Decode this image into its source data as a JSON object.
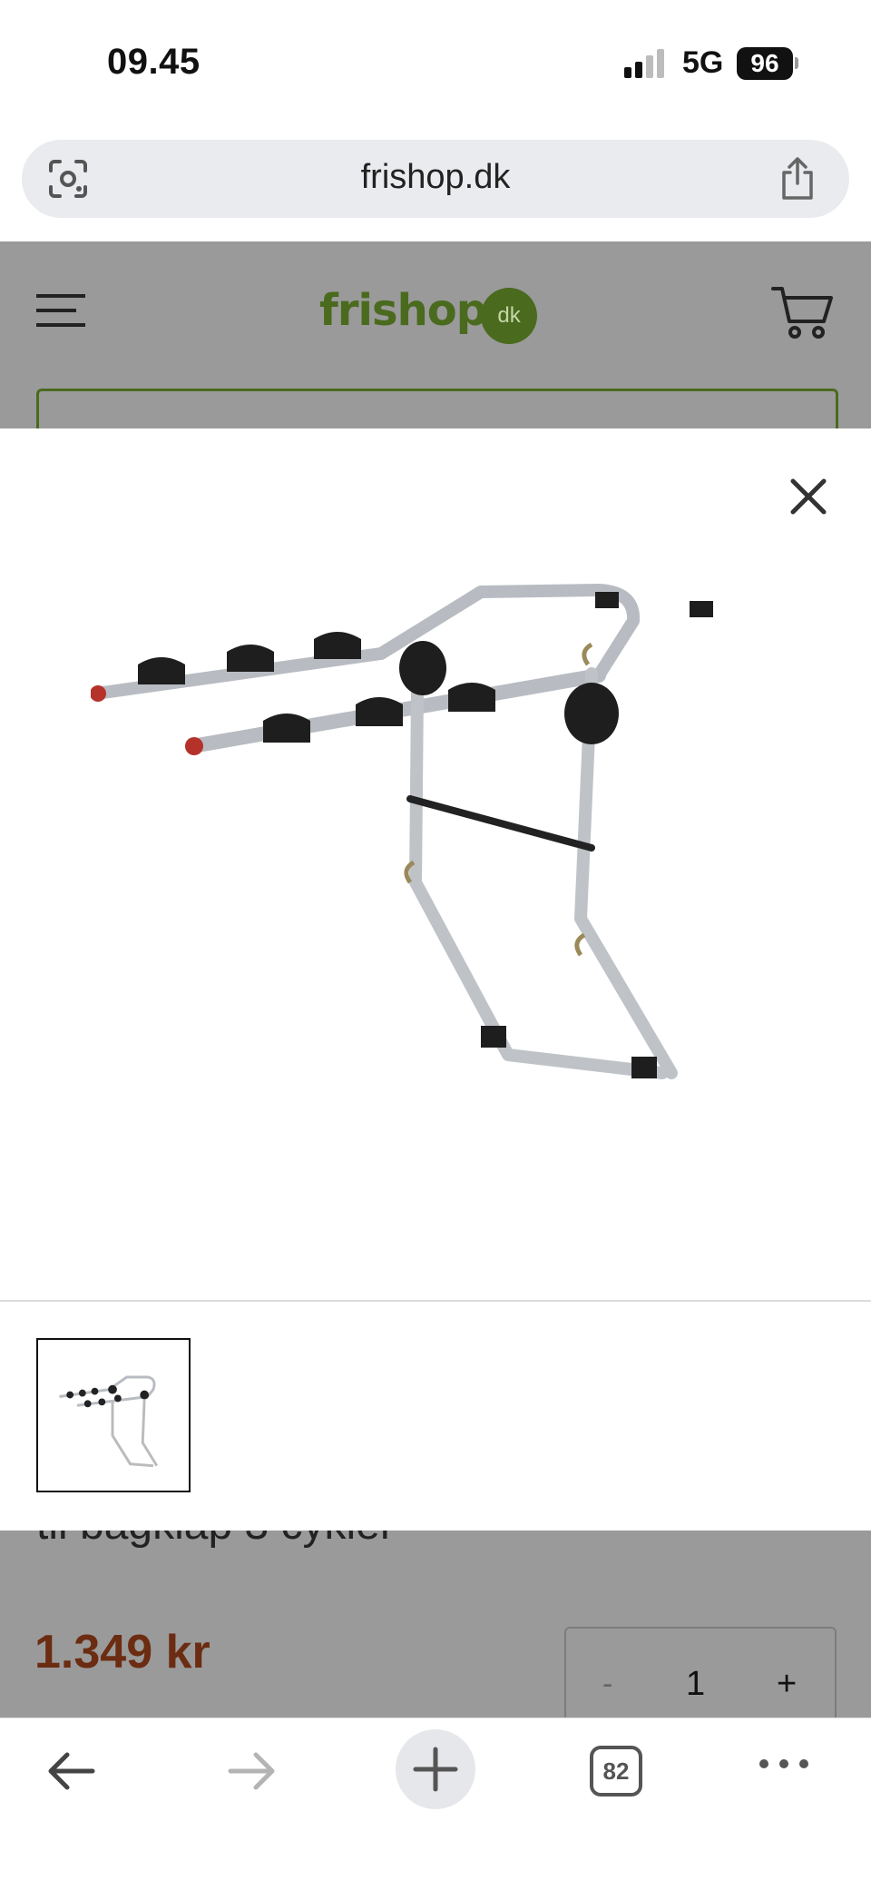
{
  "status_bar": {
    "time": "09.45",
    "network": "5G",
    "battery": "96"
  },
  "browser": {
    "url": "frishop.dk",
    "tabs_count": "82"
  },
  "site": {
    "logo_text": "frishop",
    "logo_badge": "dk",
    "brand_color": "#4a6a1e",
    "product_title_partial": "til bagklap 3 cykler",
    "price": "1.349 kr",
    "quantity": {
      "minus": "-",
      "value": "1",
      "plus": "+"
    }
  },
  "gallery": {
    "main_image": "bike-rack-3-bikes-image",
    "thumbnails": [
      "bike-rack-3-bikes-thumbnail"
    ],
    "selected_thumbnail": 0
  }
}
